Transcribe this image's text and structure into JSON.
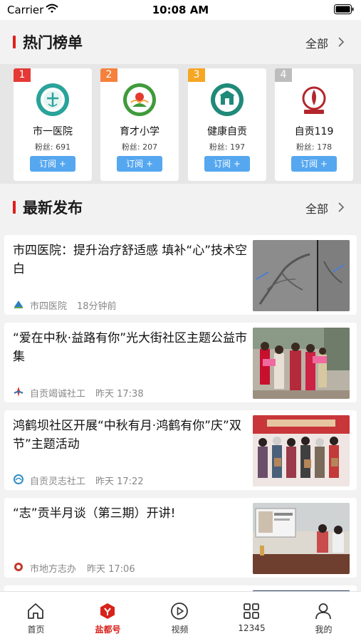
{
  "status_bar": {
    "carrier": "Carrier",
    "time": "10:08 AM"
  },
  "hot_section": {
    "title": "热门榜单",
    "more": "全部",
    "items": [
      {
        "rank": "1",
        "rank_color": "#e53935",
        "name": "市一医院",
        "fans": "粉丝: 691",
        "subscribe": "订阅 +",
        "logo": "hospital-logo"
      },
      {
        "rank": "2",
        "rank_color": "#f5813d",
        "name": "育才小学",
        "fans": "粉丝: 207",
        "subscribe": "订阅 +",
        "logo": "school-logo"
      },
      {
        "rank": "3",
        "rank_color": "#f5a623",
        "name": "健康自贡",
        "fans": "粉丝: 197",
        "subscribe": "订阅 +",
        "logo": "health-logo"
      },
      {
        "rank": "4",
        "rank_color": "#bdbdbd",
        "name": "自贡119",
        "fans": "粉丝: 178",
        "subscribe": "订阅 +",
        "logo": "fire-logo"
      }
    ]
  },
  "latest_section": {
    "title": "最新发布",
    "more": "全部",
    "items": [
      {
        "title": "市四医院：提升治疗舒适感 填补“心”技术空白",
        "source": "市四医院",
        "time": "18分钟前",
        "thumb": "angiography-image"
      },
      {
        "title": "“爱在中秋·益路有你”光大街社区主题公益市集",
        "source": "自贡竭诚社工",
        "time": "昨天 17:38",
        "thumb": "community-market-photo"
      },
      {
        "title": "鸿鹤坝社区开展“中秋有月·鸿鹤有你”庆”双节”主题活动",
        "source": "自贡灵志社工",
        "time": "昨天 17:22",
        "thumb": "festival-group-photo"
      },
      {
        "title": "“志”贡半月谈（第三期）开讲!",
        "source": "市地方志办",
        "time": "昨天 17:06",
        "thumb": "meeting-room-photo"
      }
    ]
  },
  "tab_bar": {
    "active_color": "#d8221c",
    "items": [
      {
        "label": "首页",
        "icon": "home-icon"
      },
      {
        "label": "盐都号",
        "icon": "yandu-cube-icon"
      },
      {
        "label": "视频",
        "icon": "play-circle-icon"
      },
      {
        "label": "12345",
        "icon": "grid-icon"
      },
      {
        "label": "我的",
        "icon": "person-icon"
      }
    ]
  }
}
